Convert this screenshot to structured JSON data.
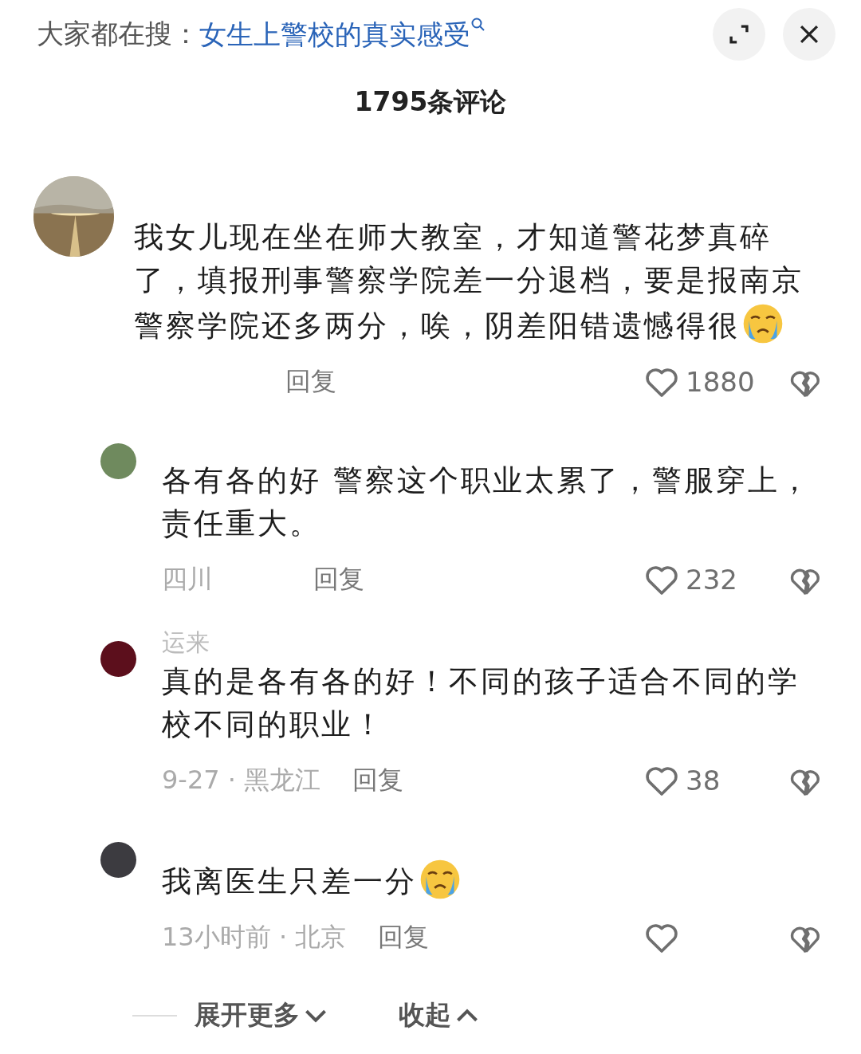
{
  "search_bar": {
    "prefix": "大家都在搜：",
    "query": "女生上警校的真实感受"
  },
  "title": "1795条评论",
  "comment": {
    "text": "我女儿现在坐在师大教室，才知道警花梦真碎了，填报刑事警察学院差一分退档，要是报南京警察学院还多两分，唉，阴差阳错遗憾得很",
    "emoji": true,
    "reply": "回复",
    "likes": "1880"
  },
  "replies": [
    {
      "color": "#6f8a5e",
      "text": "各有各的好 警察这个职业太累了，警服穿上，责任重大。",
      "emoji": false,
      "meta": "四川",
      "reply": "回复",
      "likes": "232"
    },
    {
      "color": "#5c0f1c",
      "username": "运来",
      "text": "真的是各有各的好！不同的孩子适合不同的学校不同的职业！",
      "emoji": false,
      "meta": "9-27 · 黑龙江",
      "reply": "回复",
      "likes": "38"
    },
    {
      "color": "#3c3b40",
      "text": "我离医生只差一分",
      "emoji": true,
      "meta": "13小时前 · 北京",
      "reply": "回复"
    }
  ],
  "footer": {
    "expand": "展开更多",
    "collapse": "收起"
  }
}
